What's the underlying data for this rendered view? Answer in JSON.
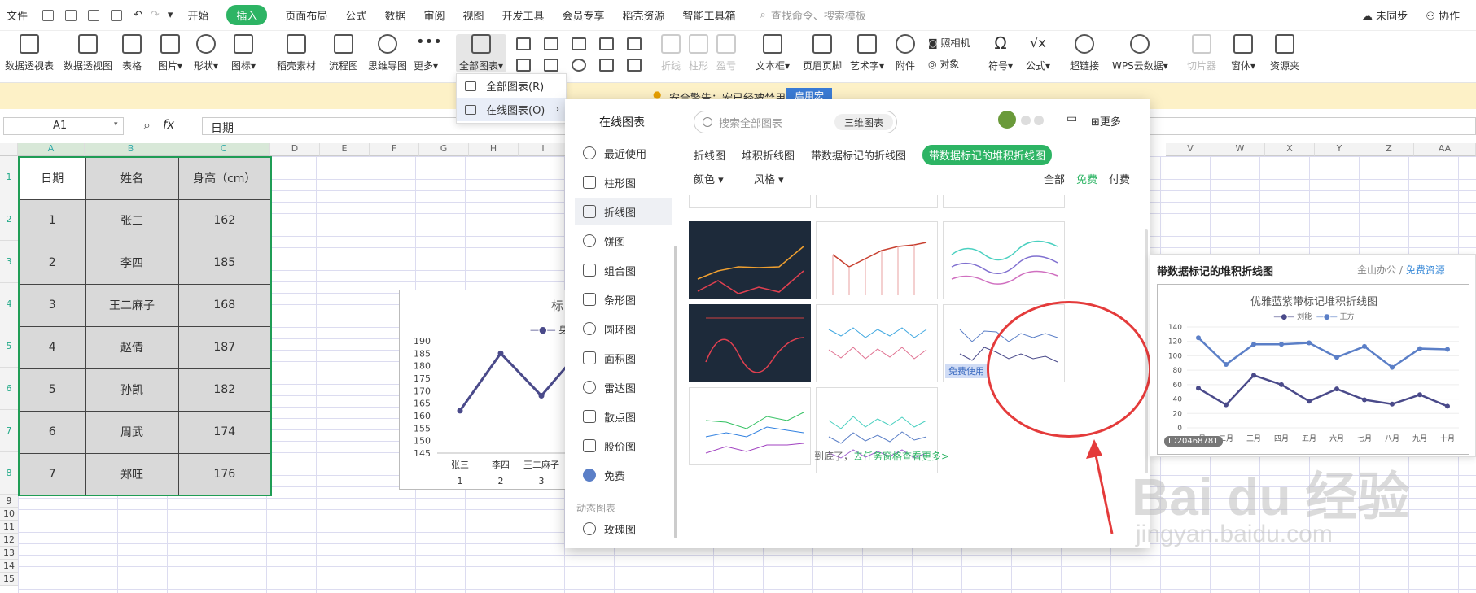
{
  "menubar": {
    "file": "文件",
    "tabs": [
      "开始",
      "插入",
      "页面布局",
      "公式",
      "数据",
      "审阅",
      "视图",
      "开发工具",
      "会员专享",
      "稻壳资源",
      "智能工具箱"
    ],
    "search": "查找命令、搜索模板",
    "sync": "未同步",
    "collab": "协作"
  },
  "ribbon": {
    "pivot_table": "数据透视表",
    "pivot_chart": "数据透视图",
    "table": "表格",
    "picture": "图片",
    "shape": "形状",
    "icon": "图标",
    "docer": "稻壳素材",
    "flowchart": "流程图",
    "mindmap": "思维导图",
    "more": "更多",
    "all_charts": "全部图表",
    "line": "折线",
    "column": "柱形",
    "winloss": "盈亏",
    "textbox": "文本框",
    "header_footer": "页眉页脚",
    "wordart": "艺术字",
    "attachment": "附件",
    "camera": "照相机",
    "object": "对象",
    "symbol": "符号",
    "formula": "公式",
    "hyperlink": "超链接",
    "wps_cloud": "WPS云数据",
    "slicer": "切片器",
    "form": "窗体",
    "resource": "资源夹"
  },
  "warning": {
    "text": "安全警告：宏已经被禁用",
    "button": "启用宏"
  },
  "formula_bar": {
    "cell": "A1",
    "fx": "fx",
    "content": "日期"
  },
  "columns": [
    "A",
    "B",
    "C",
    "D",
    "E",
    "F",
    "G",
    "H",
    "I",
    "V",
    "W",
    "X",
    "Y",
    "Z",
    "AA"
  ],
  "rows": [
    "1",
    "2",
    "3",
    "4",
    "5",
    "6",
    "7",
    "8",
    "9",
    "10",
    "11",
    "12",
    "13",
    "14",
    "15"
  ],
  "table": {
    "headers": [
      "日期",
      "姓名",
      "身高（cm）"
    ],
    "rows": [
      [
        "1",
        "张三",
        "162"
      ],
      [
        "2",
        "李四",
        "185"
      ],
      [
        "3",
        "王二麻子",
        "168"
      ],
      [
        "4",
        "赵倩",
        "187"
      ],
      [
        "5",
        "孙凯",
        "182"
      ],
      [
        "6",
        "周武",
        "174"
      ],
      [
        "7",
        "郑旺",
        "176"
      ]
    ]
  },
  "sheet_chart": {
    "title": "标",
    "legend": "身高",
    "y_ticks": [
      "190",
      "185",
      "180",
      "175",
      "170",
      "165",
      "160",
      "155",
      "150",
      "145"
    ],
    "x_names": [
      "张三",
      "李四",
      "王二麻子"
    ],
    "x_nums": [
      "1",
      "2",
      "3"
    ],
    "chart_data": {
      "type": "line",
      "categories": [
        "张三",
        "李四",
        "王二麻子",
        "赵倩"
      ],
      "values": [
        162,
        185,
        168,
        187
      ],
      "ylim": [
        145,
        190
      ]
    }
  },
  "dropdown": {
    "all_charts": "全部图表(R)",
    "online_charts": "在线图表(O)"
  },
  "panel": {
    "side_title": "在线图表",
    "side_items": [
      "最近使用",
      "柱形图",
      "折线图",
      "饼图",
      "组合图",
      "条形图",
      "圆环图",
      "面积图",
      "雷达图",
      "散点图",
      "股价图",
      "免费"
    ],
    "dynamic_group": "动态图表",
    "dynamic_item": "玫瑰图",
    "search_placeholder": "搜索全部图表",
    "btn_3d": "三维图表",
    "more": "更多",
    "tabs": [
      "折线图",
      "堆积折线图",
      "带数据标记的折线图",
      "带数据标记的堆积折线图"
    ],
    "filter_color": "颜色",
    "filter_style": "风格",
    "price_all": "全部",
    "price_free": "免费",
    "price_paid": "付费",
    "free_use": "免费使用",
    "footer_text": "到底了，",
    "footer_link": "去任务窗格查看更多>"
  },
  "preview": {
    "title": "带数据标记的堆积折线图",
    "source": "金山办公",
    "resource": "免费资源",
    "chart_title": "优雅蓝紫带标记堆积折线图",
    "legend": [
      "刘能",
      "王方"
    ],
    "id": "ID20468781",
    "y_ticks": [
      "140",
      "120",
      "100",
      "80",
      "60",
      "40",
      "20",
      "0"
    ],
    "x_labels": [
      "一月",
      "二月",
      "三月",
      "四月",
      "五月",
      "六月",
      "七月",
      "八月",
      "九月",
      "十月"
    ],
    "chart_data": {
      "type": "line",
      "categories": [
        "一月",
        "二月",
        "三月",
        "四月",
        "五月",
        "六月",
        "七月",
        "八月",
        "九月",
        "十月"
      ],
      "series": [
        {
          "name": "刘能",
          "values": [
            55,
            32,
            73,
            60,
            37,
            54,
            39,
            33,
            46,
            30
          ]
        },
        {
          "name": "王方",
          "values": [
            125,
            88,
            116,
            116,
            118,
            98,
            113,
            84,
            110,
            109
          ]
        }
      ],
      "ylim": [
        0,
        140
      ]
    }
  },
  "watermark": {
    "main": "Bai du 经验",
    "sub": "jingyan.baidu.com"
  },
  "colors": {
    "accent": "#2db464",
    "red": "#e43b3b",
    "preview_line1": "#4a4a8a",
    "preview_line2": "#5b7fc7"
  }
}
